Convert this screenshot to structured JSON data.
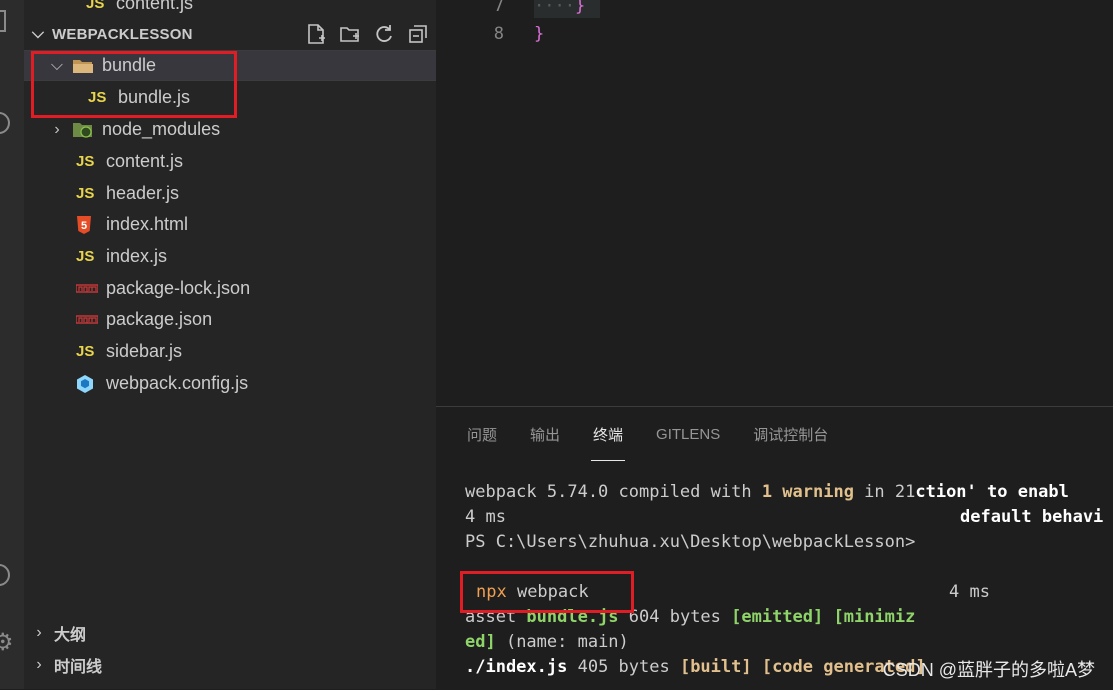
{
  "explorer": {
    "partial_top_item": "content.js",
    "section_title": "WEBPACKLESSON",
    "items": [
      {
        "label": "bundle",
        "type": "folder",
        "expanded": true
      },
      {
        "label": "bundle.js",
        "type": "js",
        "badge": "JS"
      },
      {
        "label": "node_modules",
        "type": "folder",
        "expanded": false
      },
      {
        "label": "content.js",
        "type": "js",
        "badge": "JS"
      },
      {
        "label": "header.js",
        "type": "js",
        "badge": "JS"
      },
      {
        "label": "index.html",
        "type": "html",
        "badge": "5"
      },
      {
        "label": "index.js",
        "type": "js",
        "badge": "JS"
      },
      {
        "label": "package-lock.json",
        "type": "npm",
        "badge": "npm"
      },
      {
        "label": "package.json",
        "type": "npm",
        "badge": "npm"
      },
      {
        "label": "sidebar.js",
        "type": "js",
        "badge": "JS"
      },
      {
        "label": "webpack.config.js",
        "type": "webpack"
      }
    ],
    "outline_label": "大纲",
    "timeline_label": "时间线"
  },
  "editor": {
    "line_numbers": [
      "7",
      "8"
    ],
    "line7_code": "}",
    "line8_code": "}",
    "line7_dots": "····"
  },
  "panel": {
    "tabs": [
      "问题",
      "输出",
      "终端",
      "GITLENS",
      "调试控制台"
    ],
    "active_tab": "终端",
    "terminal": {
      "line1_a": "webpack 5.74.0 compiled with ",
      "line1_b": "1 warning",
      "line1_c": " in 21",
      "line1_d": "ction' to enabl",
      "line2_a": "4 ms",
      "line2_b": "default behavi",
      "line3": "PS C:\\Users\\zhuhua.xu\\Desktop\\webpackLesson>",
      "line4_cmd": "npx",
      "line4_arg": " webpack",
      "line4_time": "4 ms",
      "line5_a": "asset ",
      "line5_b": "bundle.js",
      "line5_c": " 604 bytes ",
      "line5_d": "[emitted] [minimiz",
      "line6_a": "ed]",
      "line6_b": " (name: main)",
      "line7_a": "./index.js",
      "line7_b": " 405 bytes ",
      "line7_c": "[built] [code generated]"
    }
  },
  "watermark": "CSDN @蓝胖子的多啦A梦",
  "colors": {
    "highlight_box": "#e01c24",
    "js_badge": "#e8d44d",
    "terminal_yellow": "#e2c08d",
    "terminal_green": "#8fd469"
  }
}
